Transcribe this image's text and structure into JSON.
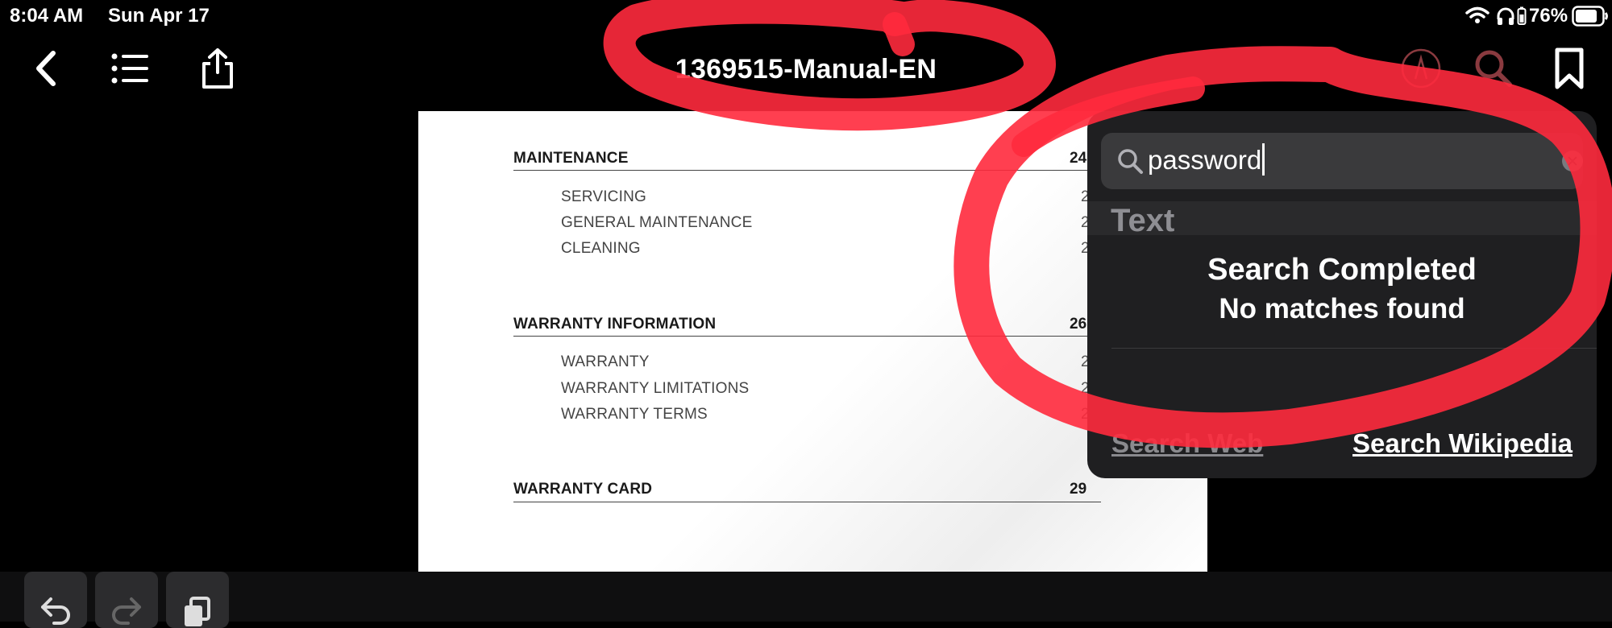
{
  "status_bar": {
    "time": "8:04 AM",
    "date": "Sun Apr 17",
    "battery": "76%"
  },
  "toolbar": {
    "title": "1369515-Manual-EN"
  },
  "document": {
    "sections": [
      {
        "title": "MAINTENANCE",
        "page": "24",
        "items": [
          {
            "label": "SERVICING",
            "page": "2"
          },
          {
            "label": "GENERAL MAINTENANCE",
            "page": "2"
          },
          {
            "label": "CLEANING",
            "page": "2"
          }
        ]
      },
      {
        "title": "WARRANTY INFORMATION",
        "page": "26",
        "items": [
          {
            "label": "WARRANTY",
            "page": "2"
          },
          {
            "label": "WARRANTY LIMITATIONS",
            "page": "2"
          },
          {
            "label": "WARRANTY TERMS",
            "page": "2"
          }
        ]
      },
      {
        "title": "WARRANTY CARD",
        "page": "29",
        "items": []
      }
    ]
  },
  "search": {
    "query": "password",
    "section_label": "Text",
    "result_title": "Search Completed",
    "result_subtitle": "No matches found",
    "search_web": "Search Web",
    "search_wikipedia": "Search Wikipedia"
  },
  "colors": {
    "annotation": "#ff2a3d",
    "popover": "#1f1f21",
    "field": "#3a3a3c"
  },
  "icons": [
    "back-icon",
    "list-icon",
    "share-icon",
    "markup-icon",
    "search-icon",
    "bookmark-icon",
    "undo-icon",
    "redo-icon",
    "copy-icon"
  ]
}
